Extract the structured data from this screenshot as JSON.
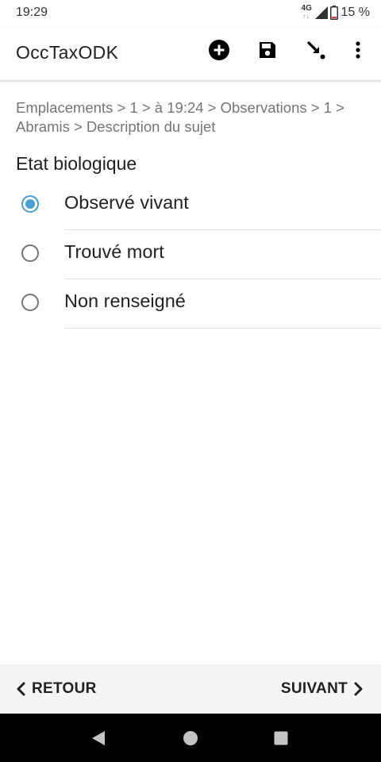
{
  "status_bar": {
    "time": "19:29",
    "network": "4G",
    "network_arrows": "↑↓",
    "battery_level": 0.15,
    "battery_text": "15 %"
  },
  "app_bar": {
    "title": "OccTaxODK",
    "actions": [
      {
        "name": "add",
        "icon": "add-circle-icon"
      },
      {
        "name": "save",
        "icon": "save-icon"
      },
      {
        "name": "jump",
        "icon": "go-to-icon"
      },
      {
        "name": "more",
        "icon": "more-vert-icon"
      }
    ]
  },
  "breadcrumb": "Emplacements > 1 > à 19:24 > Observations > 1 > Abramis > Description du sujet",
  "question": {
    "label": "Etat biologique",
    "options": [
      {
        "label": "Observé vivant",
        "selected": true
      },
      {
        "label": "Trouvé mort",
        "selected": false
      },
      {
        "label": "Non renseigné",
        "selected": false
      }
    ]
  },
  "bottom_nav": {
    "back_label": "RETOUR",
    "next_label": "SUIVANT"
  },
  "system_nav": {
    "buttons": [
      "back-triangle-icon",
      "home-circle-icon",
      "recents-square-icon"
    ]
  },
  "colors": {
    "accent": "#4a9fd1",
    "battery_low": "#e53935",
    "text_primary": "#212121",
    "text_secondary": "#757575",
    "bottom_nav_bg": "#f5f5f5",
    "system_nav_bg": "#000000"
  }
}
